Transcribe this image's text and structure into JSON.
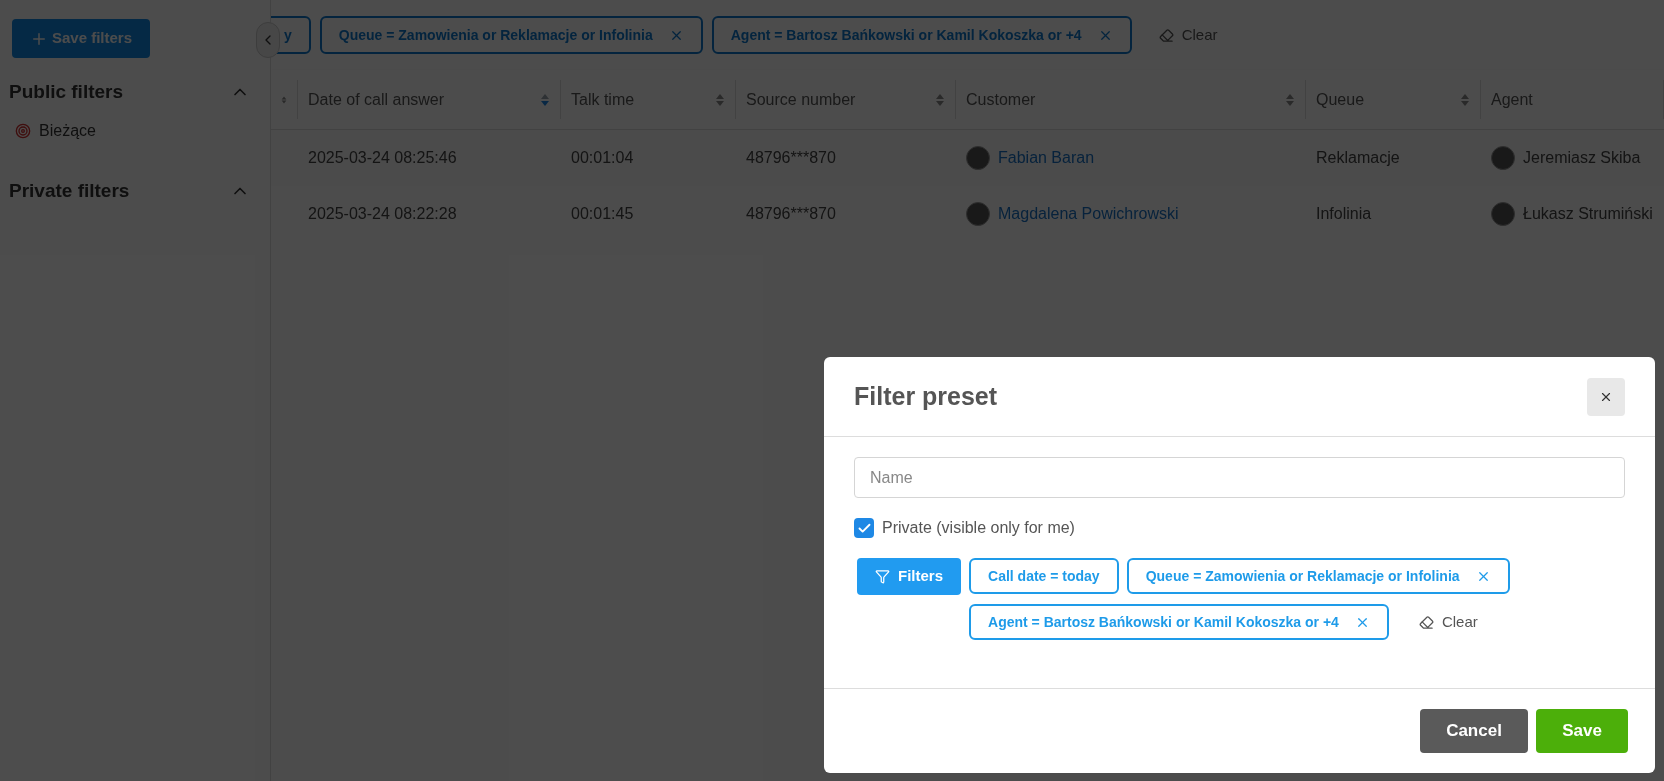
{
  "sidebar": {
    "save_button": "Save filters",
    "sections": [
      {
        "title": "Public filters",
        "expanded": true,
        "items": [
          {
            "label": "Bieżące"
          }
        ]
      },
      {
        "title": "Private filters",
        "expanded": true
      }
    ]
  },
  "active_filters": {
    "chips": [
      {
        "label": "y",
        "removable": false
      },
      {
        "label": "Queue = Zamowienia or Reklamacje or Infolinia",
        "removable": true
      },
      {
        "label": "Agent = Bartosz Bańkowski or Kamil Kokoszka or +4",
        "removable": true
      }
    ],
    "clear": "Clear"
  },
  "table": {
    "columns": [
      {
        "sortable": true,
        "sorted": false
      },
      {
        "label": "Date of call answer",
        "sortable": true,
        "sorted": true
      },
      {
        "label": "Talk time",
        "sortable": true,
        "sorted": false
      },
      {
        "label": "Source number",
        "sortable": true,
        "sorted": false
      },
      {
        "label": "Customer",
        "sortable": true,
        "sorted": false
      },
      {
        "label": "Queue",
        "sortable": true,
        "sorted": false
      },
      {
        "label": "Agent",
        "sortable": false
      }
    ],
    "rows": [
      {
        "date": "2025-03-24 08:25:46",
        "talk_time": "00:01:04",
        "source": "48796***870",
        "customer": "Fabian Baran",
        "queue": "Reklamacje",
        "agent": "Jeremiasz Skiba"
      },
      {
        "date": "2025-03-24 08:22:28",
        "talk_time": "00:01:45",
        "source": "48796***870",
        "customer": "Magdalena Powichrowski",
        "queue": "Infolinia",
        "agent": "Łukasz Strumiński"
      }
    ]
  },
  "modal": {
    "title": "Filter preset",
    "name_placeholder": "Name",
    "private": {
      "label": "Private (visible only for me)",
      "checked": true
    },
    "filters_button": "Filters",
    "chips": [
      {
        "label": "Call date = today",
        "removable": false
      },
      {
        "label": "Queue = Zamowienia or Reklamacje or Infolinia",
        "removable": true
      },
      {
        "label": "Agent = Bartosz Bańkowski or Kamil Kokoszka or +4",
        "removable": true
      }
    ],
    "clear": "Clear",
    "cancel": "Cancel",
    "save": "Save"
  }
}
